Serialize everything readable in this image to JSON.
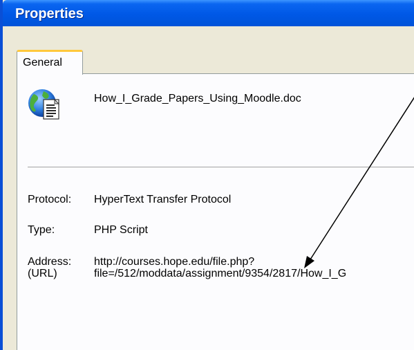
{
  "window": {
    "title": "Properties"
  },
  "tabs": [
    {
      "label": "General",
      "active": true
    }
  ],
  "file": {
    "icon": "web-document-icon",
    "name": "How_I_Grade_Papers_Using_Moodle.doc"
  },
  "properties": {
    "protocol": {
      "label": "Protocol:",
      "value": "HyperText Transfer Protocol"
    },
    "type": {
      "label": "Type:",
      "value": "PHP Script"
    },
    "address": {
      "label_line1": "Address:",
      "label_line2": "(URL)",
      "value_line1": "http://courses.hope.edu/file.php?",
      "value_line2": "file=/512/moddata/assignment/9354/2817/How_I_G"
    }
  },
  "annotation": {
    "icon": "arrow-pointer-icon"
  },
  "colors": {
    "titlebar": "#0058e6",
    "window_bg": "#ece9d8",
    "panel_bg": "#fcfcfe",
    "tab_highlight": "#ffc83c"
  }
}
